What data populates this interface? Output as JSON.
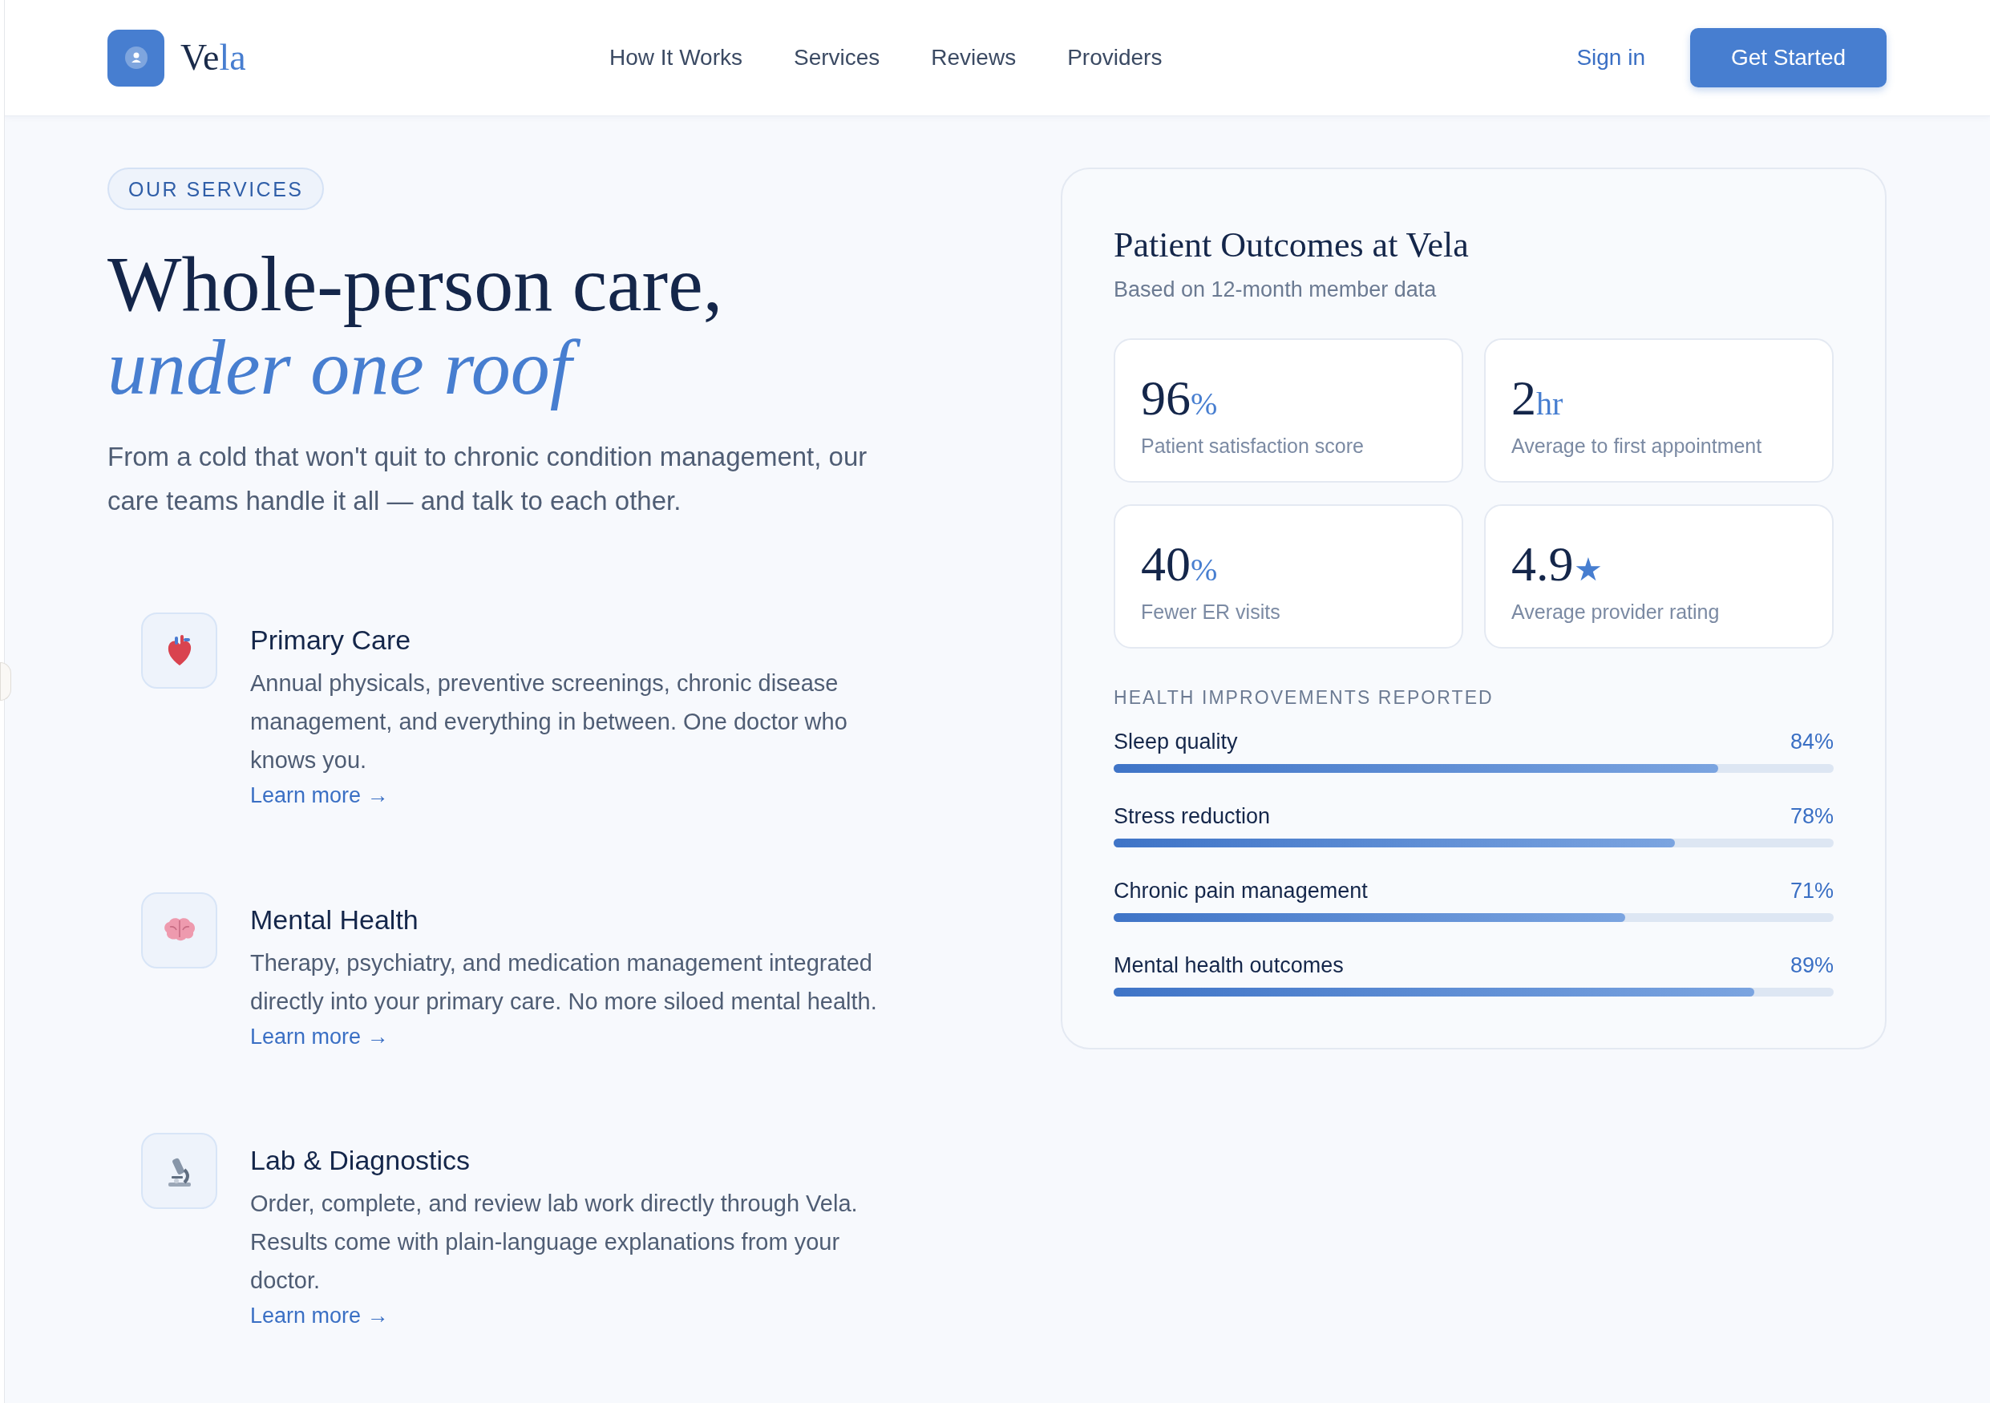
{
  "brand": {
    "name_dark": "Ve",
    "name_accent": "la"
  },
  "nav": {
    "links": [
      "How It Works",
      "Services",
      "Reviews",
      "Providers"
    ],
    "sign_in": "Sign in",
    "cta": "Get Started"
  },
  "hero": {
    "badge": "OUR SERVICES",
    "title_line1": "Whole-person care,",
    "title_line2": "under one roof",
    "intro": "From a cold that won't quit to chronic condition management, our care teams handle it all — and talk to each other."
  },
  "services": [
    {
      "kind": "heart",
      "title": "Primary Care",
      "description": "Annual physicals, preventive screenings, chronic disease management, and everything in between. One doctor who knows you.",
      "link": "Learn more →"
    },
    {
      "kind": "brain",
      "title": "Mental Health",
      "description": "Therapy, psychiatry, and medication management integrated directly into your primary care. No more siloed mental health.",
      "link": "Learn more →"
    },
    {
      "kind": "microscope",
      "title": "Lab & Diagnostics",
      "description": "Order, complete, and review lab work directly through Vela. Results come with plain-language explanations from your doctor.",
      "link": "Learn more →"
    }
  ],
  "outcomes": {
    "title": "Patient Outcomes at Vela",
    "subtitle": "Based on 12-month member data",
    "stats": [
      {
        "value": "96",
        "unit": "%",
        "label": "Patient satisfaction score"
      },
      {
        "value": "2",
        "unit": "hr",
        "label": "Average to first appointment"
      },
      {
        "value": "40",
        "unit": "%",
        "label": "Fewer ER visits"
      },
      {
        "value": "4.9",
        "unit": "★",
        "label": "Average provider rating"
      }
    ],
    "improvements_heading": "HEALTH IMPROVEMENTS REPORTED",
    "improvements": [
      {
        "label": "Sleep quality",
        "reading": "84%",
        "level": 0.84
      },
      {
        "label": "Stress reduction",
        "reading": "78%",
        "level": 0.78
      },
      {
        "label": "Chronic pain management",
        "reading": "71%",
        "level": 0.71
      },
      {
        "label": "Mental health outcomes",
        "reading": "89%",
        "level": 0.89
      }
    ]
  }
}
